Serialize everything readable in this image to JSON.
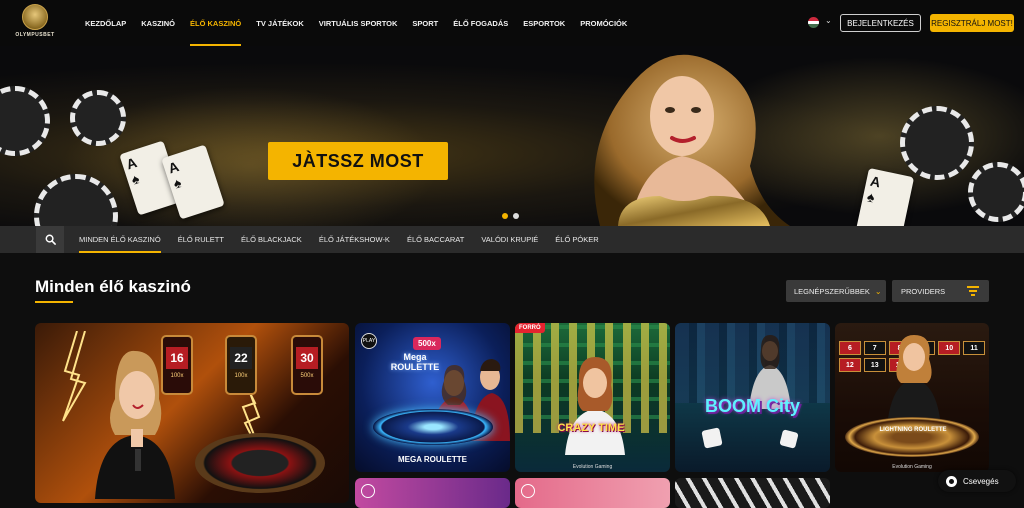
{
  "brand": {
    "logo_text": "OLYMPUSBET"
  },
  "nav": {
    "items": [
      {
        "label": "KEZDŐLAP",
        "active": false
      },
      {
        "label": "KASZINÓ",
        "active": false
      },
      {
        "label": "ÉLŐ KASZINÓ",
        "active": true
      },
      {
        "label": "TV JÁTÉKOK",
        "active": false
      },
      {
        "label": "VIRTUÁLIS SPORTOK",
        "active": false
      },
      {
        "label": "SPORT",
        "active": false
      },
      {
        "label": "ÉLŐ FOGADÁS",
        "active": false
      },
      {
        "label": "ESPORTOK",
        "active": false
      },
      {
        "label": "PROMÓCIÓK",
        "active": false
      }
    ],
    "login_label": "BEJELENTKEZÉS",
    "register_label": "REGISZTRÁLJ MOST!",
    "language_flag": "hungary-flag-icon",
    "colors": {
      "accent": "#f4b400",
      "bg": "#0a0a0a"
    }
  },
  "hero": {
    "cta_label": "JÀTSSZ MOST",
    "slides": 2,
    "active_slide": 1
  },
  "subnav": {
    "search_icon": "search-icon",
    "items": [
      {
        "label": "MINDEN ÉLŐ KASZINÓ",
        "active": true
      },
      {
        "label": "ÉLŐ RULETT",
        "active": false
      },
      {
        "label": "ÉLŐ BLACKJACK",
        "active": false
      },
      {
        "label": "ÉLŐ JÁTÉKSHOW-K",
        "active": false
      },
      {
        "label": "ÉLŐ BACCARAT",
        "active": false
      },
      {
        "label": "VALÓDI KRUPIÉ",
        "active": false
      },
      {
        "label": "ÉLŐ PÓKER",
        "active": false
      }
    ]
  },
  "section": {
    "title": "Minden élő kaszinó",
    "sort_label": "LEGNÉPSZERŰBBEK",
    "providers_label": "PROVIDERS"
  },
  "tiles": {
    "xxxtreme": {
      "numbers": [
        "16",
        "22",
        "30"
      ],
      "multipliers": [
        "100x",
        "100x",
        "500x"
      ]
    },
    "mega_roulette": {
      "label": "MEGA ROULETTE",
      "logo": "Mega ROULETTE",
      "multiplier": "500x",
      "play_badge": "PLAY"
    },
    "crazy_time": {
      "badge": "FORRÓ",
      "logo": "CRAZY TIME",
      "provider": "Evolution Gaming"
    },
    "boom_city": {
      "logo": "BOOM City"
    },
    "lightning_roulette": {
      "logo": "LIGHTNING ROULETTE",
      "provider": "Evolution Gaming",
      "numbers": [
        "6",
        "7",
        "8",
        "9",
        "10",
        "11",
        "12",
        "13",
        "14"
      ]
    }
  },
  "chat": {
    "label": "Csevegés"
  }
}
